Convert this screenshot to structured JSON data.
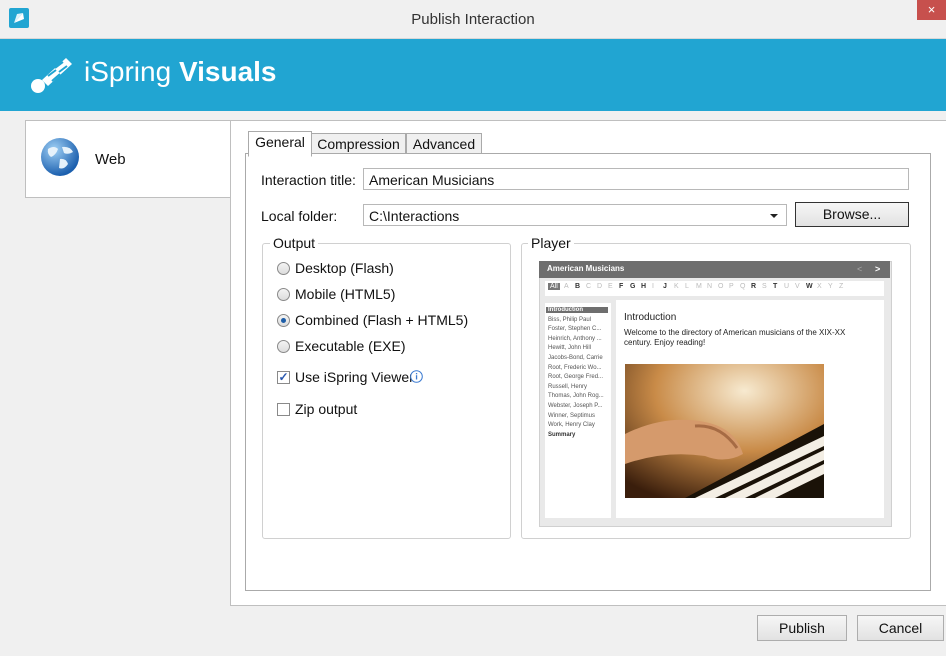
{
  "window": {
    "title": "Publish Interaction",
    "close_glyph": "×"
  },
  "banner": {
    "brand_light": "iSpring ",
    "brand_bold": "Visuals"
  },
  "sidebar": {
    "items": [
      {
        "label": "Web",
        "icon": "globe-icon"
      }
    ]
  },
  "tabs": [
    {
      "label": "General",
      "active": true
    },
    {
      "label": "Compression"
    },
    {
      "label": "Advanced"
    }
  ],
  "general": {
    "title_label": "Interaction title:",
    "title_value": "American Musicians",
    "folder_label": "Local folder:",
    "folder_value": "C:\\Interactions",
    "browse_label": "Browse..."
  },
  "output": {
    "legend": "Output",
    "options": [
      "Desktop (Flash)",
      "Mobile (HTML5)",
      "Combined (Flash + HTML5)",
      "Executable (EXE)"
    ],
    "selected": "Combined (Flash + HTML5)",
    "use_viewer_label": "Use iSpring Viewer",
    "use_viewer_checked": true,
    "zip_label": "Zip output",
    "zip_checked": false
  },
  "player": {
    "legend": "Player",
    "header_title": "American Musicians",
    "letters": [
      "All",
      "A",
      "B",
      "C",
      "D",
      "E",
      "F",
      "G",
      "H",
      "I",
      "J",
      "K",
      "L",
      "M",
      "N",
      "O",
      "P",
      "Q",
      "R",
      "S",
      "T",
      "U",
      "V",
      "W",
      "X",
      "Y",
      "Z"
    ],
    "list": [
      "Introduction",
      "Biss, Philip Paul",
      "Foster, Stephen C...",
      "Heinrich, Anthony ...",
      "Hewitt, John Hill",
      "Jacobs-Bond, Carrie",
      "Root, Frederic Wo...",
      "Root, George Fred...",
      "Russell, Henry",
      "Thomas, John Rog...",
      "Webster, Joseph P...",
      "Winner, Septimus",
      "Work, Henry Clay",
      "Summary"
    ],
    "content_title": "Introduction",
    "content_text": "Welcome to the directory of American musicians of the XIX-XX century. Enjoy reading!"
  },
  "footer": {
    "publish_label": "Publish",
    "cancel_label": "Cancel"
  },
  "colors": {
    "accent": "#21a5d2",
    "close": "#c7504d"
  }
}
